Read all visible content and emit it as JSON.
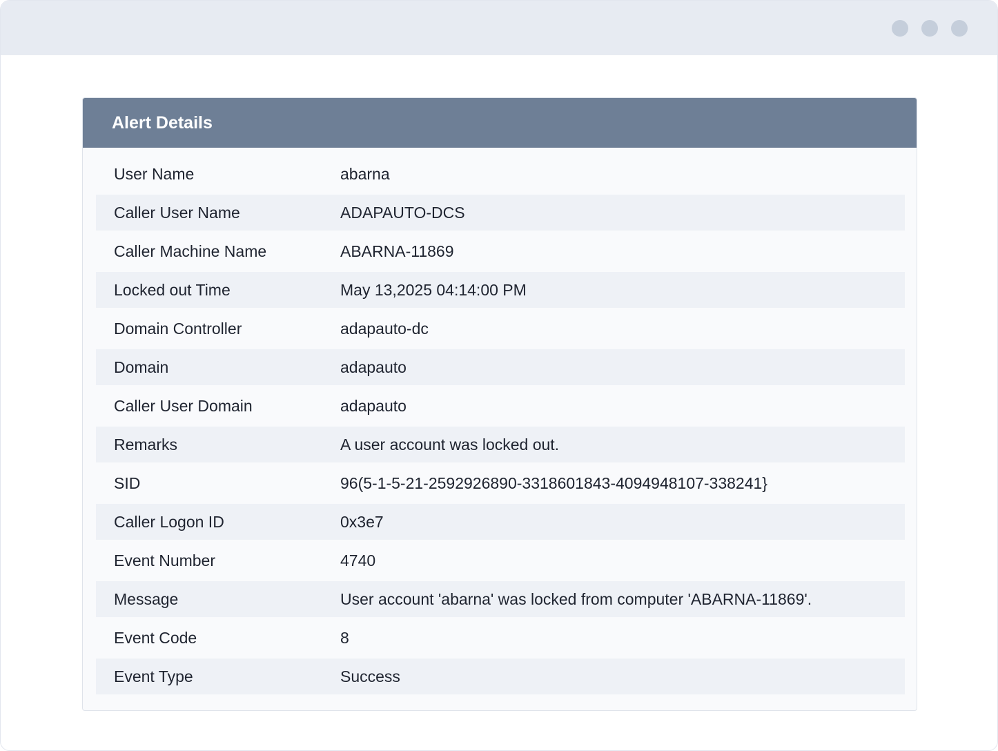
{
  "panel": {
    "title": "Alert Details"
  },
  "rows": [
    {
      "label": "User Name",
      "value": "abarna"
    },
    {
      "label": "Caller User Name",
      "value": "ADAPAUTO-DCS"
    },
    {
      "label": "Caller Machine Name",
      "value": "ABARNA-11869"
    },
    {
      "label": "Locked out Time",
      "value": "May 13,2025 04:14:00 PM"
    },
    {
      "label": "Domain Controller",
      "value": "adapauto-dc"
    },
    {
      "label": "Domain",
      "value": "adapauto"
    },
    {
      "label": "Caller User Domain",
      "value": "adapauto"
    },
    {
      "label": "Remarks",
      "value": "A user account was locked out."
    },
    {
      "label": "SID",
      "value": "96(5-1-5-21-2592926890-3318601843-4094948107-338241}"
    },
    {
      "label": "Caller Logon ID",
      "value": "0x3e7"
    },
    {
      "label": "Event Number",
      "value": "4740"
    },
    {
      "label": "Message",
      "value": "User account 'abarna' was locked from computer 'ABARNA-11869'."
    },
    {
      "label": "Event Code",
      "value": "8"
    },
    {
      "label": "Event Type",
      "value": "Success"
    }
  ],
  "colors": {
    "header_bg": "#6e7f96",
    "titlebar_bg": "#e7ebf2",
    "window_dot": "#c5cedb",
    "row_alt_bg": "#eef1f6"
  }
}
